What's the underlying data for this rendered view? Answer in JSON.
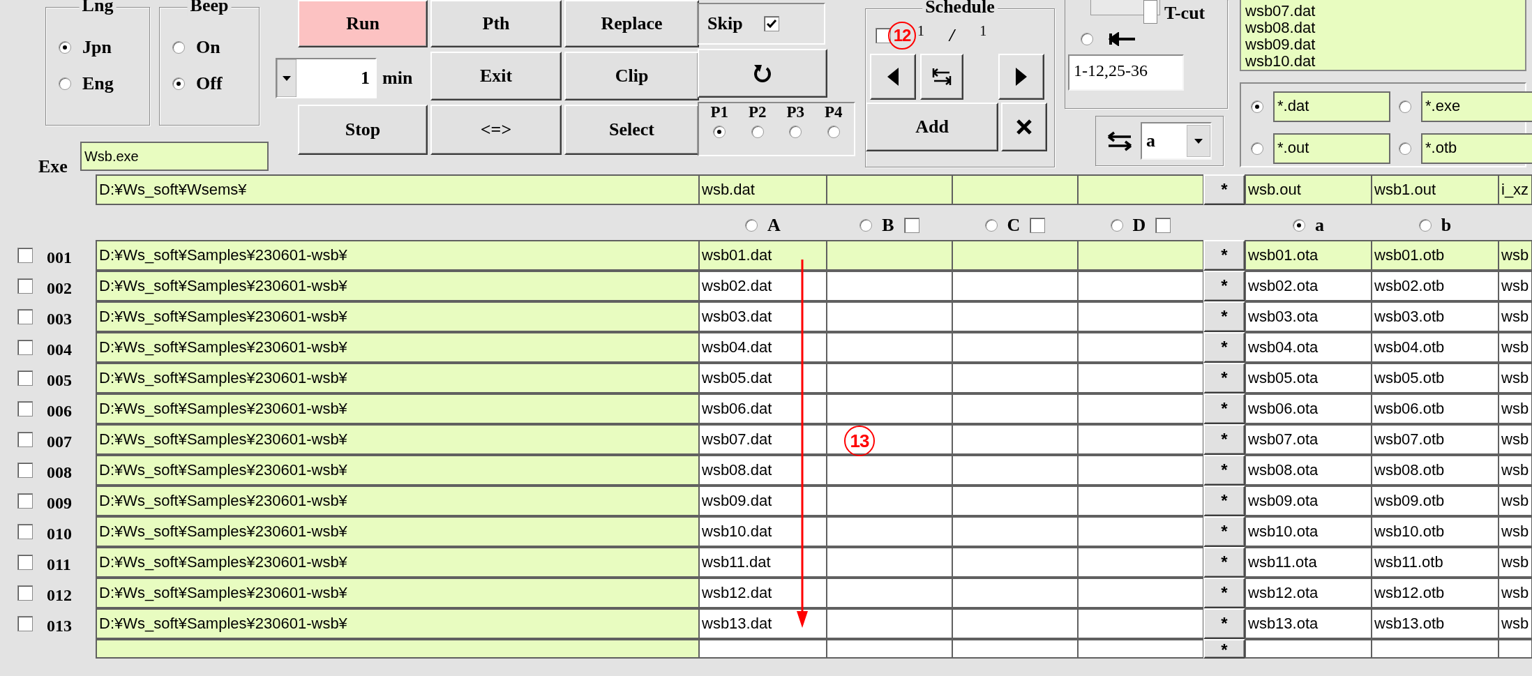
{
  "language": {
    "title": "Lng",
    "options": [
      {
        "label": "Jpn",
        "selected": true
      },
      {
        "label": "Eng",
        "selected": false
      }
    ]
  },
  "beep": {
    "title": "Beep",
    "options": [
      {
        "label": "On",
        "selected": false
      },
      {
        "label": "Off",
        "selected": true
      }
    ]
  },
  "exe": {
    "label": "Exe",
    "value": "Wsb.exe"
  },
  "buttons": [
    {
      "label": "Run",
      "active": true
    },
    {
      "label": "Pth",
      "active": false
    },
    {
      "label": "Replace",
      "active": false
    },
    {
      "label": "Exit",
      "active": false
    },
    {
      "label": "Clip",
      "active": false
    },
    {
      "label": "Stop",
      "active": false
    },
    {
      "label": "<=>",
      "active": false
    },
    {
      "label": "Select",
      "active": false
    }
  ],
  "interval": {
    "value": "1",
    "unit": "min"
  },
  "skip": {
    "label": "Skip",
    "checked": true
  },
  "priority": [
    {
      "label": "P1",
      "selected": true
    },
    {
      "label": "P2",
      "selected": false
    },
    {
      "label": "P3",
      "selected": false
    },
    {
      "label": "P4",
      "selected": false
    }
  ],
  "schedule": {
    "title": "Schedule",
    "checked": false,
    "marker": "12",
    "current": "1",
    "separator": "/",
    "total": "1",
    "add": "Add"
  },
  "tcut": {
    "label": "T-cut",
    "slider": {
      "level": 0.95
    },
    "selected": false,
    "range": "1-12,25-36"
  },
  "swap": {
    "value": "a"
  },
  "file_list": [
    "wsb07.dat",
    "wsb08.dat",
    "wsb09.dat",
    "wsb10.dat"
  ],
  "filters": [
    {
      "pattern": "*.dat",
      "selected": true
    },
    {
      "pattern": "*.exe",
      "selected": false
    },
    {
      "pattern": "*.out",
      "selected": false
    },
    {
      "pattern": "*.otb",
      "selected": false
    }
  ],
  "base": {
    "path": "D:¥Ws_soft¥Wsems¥",
    "inputs": [
      "wsb.dat"
    ],
    "action": "*",
    "outputs": [
      "wsb.out",
      "wsb1.out",
      "i_xz"
    ]
  },
  "input_columns": [
    {
      "label": "A",
      "kind": "radio",
      "selected": false
    },
    {
      "label": "B",
      "kind": "radio-check",
      "selected": false,
      "checked": false
    },
    {
      "label": "C",
      "kind": "radio-check",
      "selected": false,
      "checked": false
    },
    {
      "label": "D",
      "kind": "radio-check",
      "selected": false,
      "checked": false
    }
  ],
  "output_columns": [
    {
      "label": "a",
      "selected": true
    },
    {
      "label": "b",
      "selected": false
    }
  ],
  "rows": [
    {
      "checked": false,
      "number": "001",
      "path": "D:¥Ws_soft¥Samples¥230601-wsb¥",
      "inputs": [
        "wsb01.dat"
      ],
      "action": "*",
      "outputs": [
        "wsb01.ota",
        "wsb01.otb",
        "wsb"
      ],
      "highlighted": true
    },
    {
      "checked": false,
      "number": "002",
      "path": "D:¥Ws_soft¥Samples¥230601-wsb¥",
      "inputs": [
        "wsb02.dat"
      ],
      "action": "*",
      "outputs": [
        "wsb02.ota",
        "wsb02.otb",
        "wsb"
      ],
      "highlighted": false
    },
    {
      "checked": false,
      "number": "003",
      "path": "D:¥Ws_soft¥Samples¥230601-wsb¥",
      "inputs": [
        "wsb03.dat"
      ],
      "action": "*",
      "outputs": [
        "wsb03.ota",
        "wsb03.otb",
        "wsb"
      ],
      "highlighted": false
    },
    {
      "checked": false,
      "number": "004",
      "path": "D:¥Ws_soft¥Samples¥230601-wsb¥",
      "inputs": [
        "wsb04.dat"
      ],
      "action": "*",
      "outputs": [
        "wsb04.ota",
        "wsb04.otb",
        "wsb"
      ],
      "highlighted": false
    },
    {
      "checked": false,
      "number": "005",
      "path": "D:¥Ws_soft¥Samples¥230601-wsb¥",
      "inputs": [
        "wsb05.dat"
      ],
      "action": "*",
      "outputs": [
        "wsb05.ota",
        "wsb05.otb",
        "wsb"
      ],
      "highlighted": false
    },
    {
      "checked": false,
      "number": "006",
      "path": "D:¥Ws_soft¥Samples¥230601-wsb¥",
      "inputs": [
        "wsb06.dat"
      ],
      "action": "*",
      "outputs": [
        "wsb06.ota",
        "wsb06.otb",
        "wsb"
      ],
      "highlighted": false
    },
    {
      "checked": false,
      "number": "007",
      "path": "D:¥Ws_soft¥Samples¥230601-wsb¥",
      "inputs": [
        "wsb07.dat"
      ],
      "action": "*",
      "outputs": [
        "wsb07.ota",
        "wsb07.otb",
        "wsb"
      ],
      "highlighted": false
    },
    {
      "checked": false,
      "number": "008",
      "path": "D:¥Ws_soft¥Samples¥230601-wsb¥",
      "inputs": [
        "wsb08.dat"
      ],
      "action": "*",
      "outputs": [
        "wsb08.ota",
        "wsb08.otb",
        "wsb"
      ],
      "highlighted": false
    },
    {
      "checked": false,
      "number": "009",
      "path": "D:¥Ws_soft¥Samples¥230601-wsb¥",
      "inputs": [
        "wsb09.dat"
      ],
      "action": "*",
      "outputs": [
        "wsb09.ota",
        "wsb09.otb",
        "wsb"
      ],
      "highlighted": false
    },
    {
      "checked": false,
      "number": "010",
      "path": "D:¥Ws_soft¥Samples¥230601-wsb¥",
      "inputs": [
        "wsb10.dat"
      ],
      "action": "*",
      "outputs": [
        "wsb10.ota",
        "wsb10.otb",
        "wsb"
      ],
      "highlighted": false
    },
    {
      "checked": false,
      "number": "011",
      "path": "D:¥Ws_soft¥Samples¥230601-wsb¥",
      "inputs": [
        "wsb11.dat"
      ],
      "action": "*",
      "outputs": [
        "wsb11.ota",
        "wsb11.otb",
        "wsb"
      ],
      "highlighted": false
    },
    {
      "checked": false,
      "number": "012",
      "path": "D:¥Ws_soft¥Samples¥230601-wsb¥",
      "inputs": [
        "wsb12.dat"
      ],
      "action": "*",
      "outputs": [
        "wsb12.ota",
        "wsb12.otb",
        "wsb"
      ],
      "highlighted": false
    },
    {
      "checked": false,
      "number": "013",
      "path": "D:¥Ws_soft¥Samples¥230601-wsb¥",
      "inputs": [
        "wsb13.dat"
      ],
      "action": "*",
      "outputs": [
        "wsb13.ota",
        "wsb13.otb",
        "wsb"
      ],
      "highlighted": false
    }
  ],
  "blank_row": {
    "action": "*"
  },
  "annotation": {
    "marker": "13"
  }
}
